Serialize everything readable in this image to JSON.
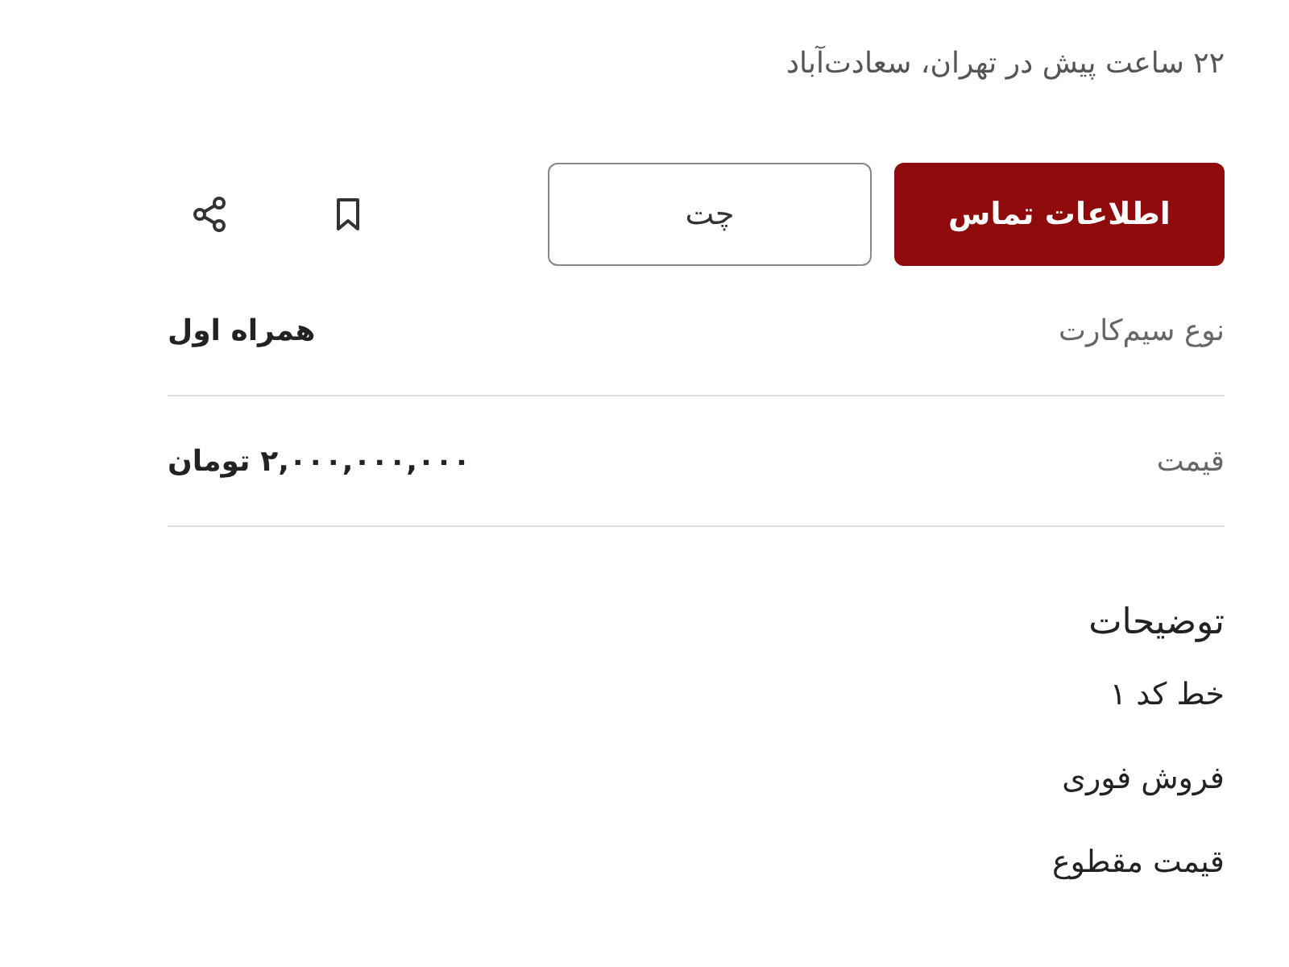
{
  "meta": "۲۲ ساعت پیش در تهران، سعادت‌آباد",
  "actions": [
    {
      "label": "اطلاعات تماس",
      "kind": "primary"
    },
    {
      "label": "چت",
      "kind": "outline"
    }
  ],
  "details": [
    {
      "label": "نوع سیم‌کارت",
      "value": "همراه اول"
    },
    {
      "label": "قیمت",
      "value": "۲,۰۰۰,۰۰۰,۰۰۰ تومان"
    }
  ],
  "description": {
    "title": "توضیحات",
    "lines": [
      "خط کد ۱",
      "فروش فوری",
      "قیمت مقطوع"
    ]
  }
}
